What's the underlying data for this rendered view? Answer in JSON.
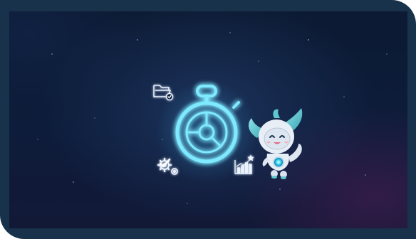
{
  "scene": {
    "frame_color": "#17324a",
    "background_colors": [
      "#0c1a33",
      "#0d1c3a",
      "#121937"
    ],
    "glow_color": "#6fe4ff",
    "accent_color": "#2fd3f0",
    "robot_body_color": "#e8eef6",
    "robot_ear_color": "#5fc7d0",
    "icons": [
      "folder-check-icon",
      "stopwatch-icon",
      "gears-check-icon",
      "chart-star-icon",
      "robot-mascot"
    ]
  }
}
